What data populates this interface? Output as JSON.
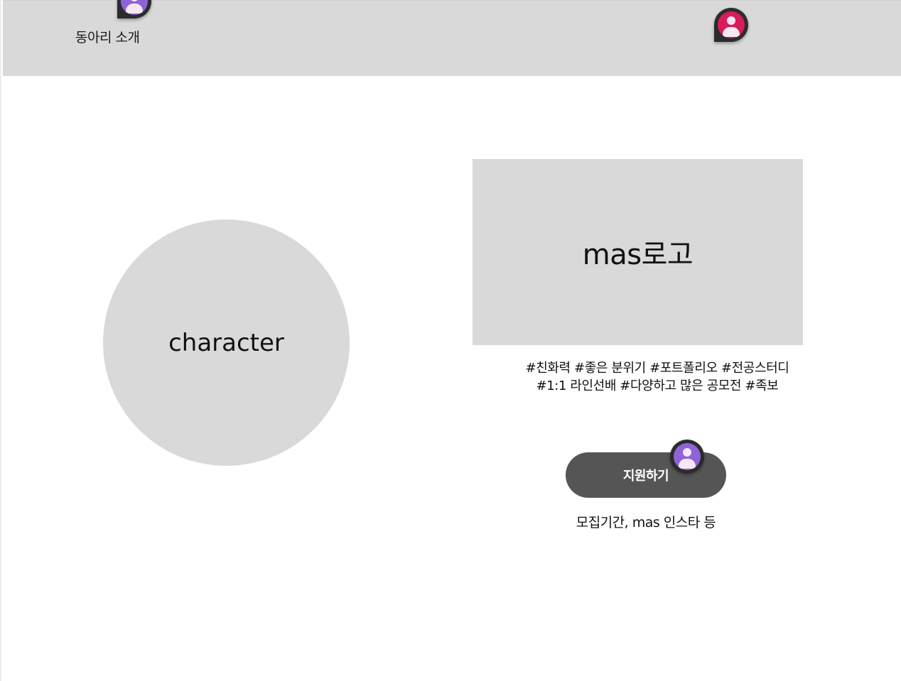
{
  "header": {
    "nav_link": "동아리 소개",
    "bg_color": "#d9d9d9"
  },
  "main": {
    "character_label": "character",
    "logo_label": "mas로고",
    "tags": [
      "#친화력 #좋은 분위기 #포트폴리오 #전공스터디",
      "#1:1 라인선배 #다양하고 많은 공모전 #족보"
    ],
    "apply_button": "지원하기",
    "info_text": "모집기간, mas 인스타 등"
  },
  "avatars": {
    "top_avatar_color": "#8e63d8",
    "user_avatar_color": "#d81b5c",
    "apply_avatar_color": "#8e63d8"
  },
  "colors": {
    "placeholder": "#d9d9d9",
    "button": "#555555"
  }
}
